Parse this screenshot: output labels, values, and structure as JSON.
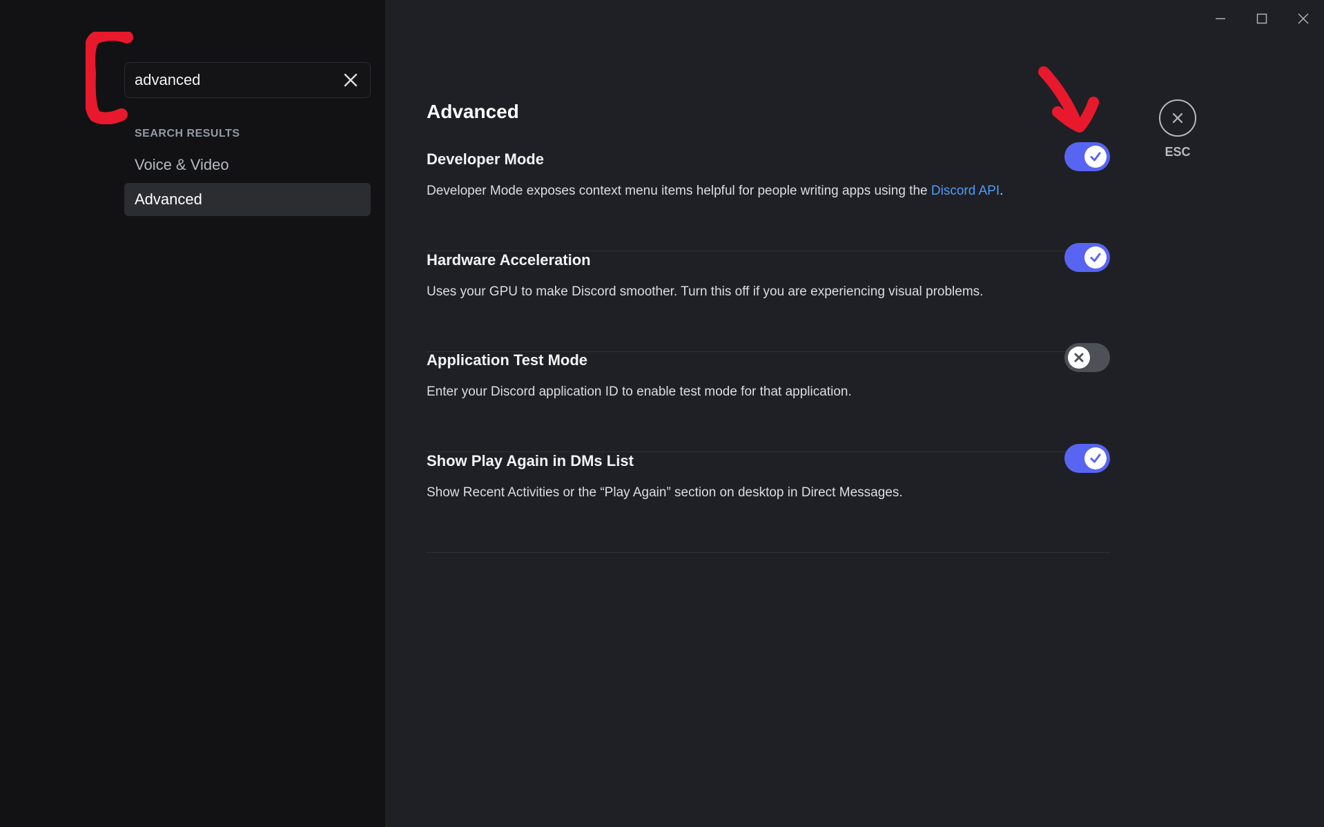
{
  "search": {
    "value": "advanced"
  },
  "sidebar": {
    "section_label": "SEARCH RESULTS",
    "items": [
      {
        "label": "Voice & Video",
        "selected": false
      },
      {
        "label": "Advanced",
        "selected": true
      }
    ]
  },
  "main": {
    "title": "Advanced",
    "esc_label": "ESC",
    "settings": [
      {
        "title": "Developer Mode",
        "description": "Developer Mode exposes context menu items helpful for people writing apps using the ",
        "link_text": "Discord API",
        "description_suffix": ".",
        "enabled": true
      },
      {
        "title": "Hardware Acceleration",
        "description": "Uses your GPU to make Discord smoother. Turn this off if you are experiencing visual problems.",
        "enabled": true
      },
      {
        "title": "Application Test Mode",
        "description": "Enter your Discord application ID to enable test mode for that application.",
        "enabled": false
      },
      {
        "title": "Show Play Again in DMs List",
        "description": "Show Recent Activities or the “Play Again” section on desktop in Direct Messages.",
        "enabled": true
      }
    ]
  },
  "colors": {
    "accent": "#5865f2",
    "link": "#4e9cf6",
    "annotation": "#e8192c",
    "toggle_off": "#4e5058"
  },
  "icons": {
    "search_clear": "close-icon",
    "toggle_on": "check-icon",
    "toggle_off": "x-icon",
    "esc": "close-circle-icon",
    "window": [
      "minimize-icon",
      "maximize-icon",
      "window-close-icon"
    ]
  }
}
